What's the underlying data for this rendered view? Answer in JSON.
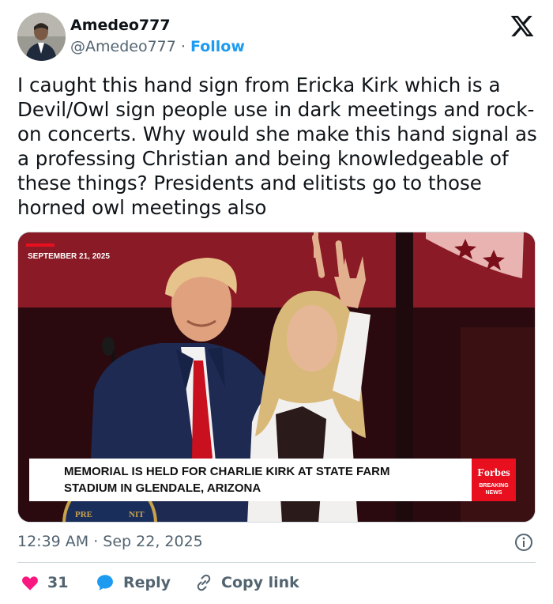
{
  "author": {
    "display_name": "Amedeo777",
    "handle": "@Amedeo777",
    "separator": "·",
    "follow_label": "Follow"
  },
  "tweet": {
    "text": "I caught this hand sign from Ericka Kirk which is a Devil/Owl sign people use in dark meetings and rock-on concerts. Why would she make this hand signal as a professing Christian and being knowledgeable of these things? Presidents and elitists go to those horned owl meetings also"
  },
  "media": {
    "date_label": "SEPTEMBER 21, 2025",
    "headline_line1": "MEMORIAL IS HELD FOR CHARLIE KIRK AT STATE FARM",
    "headline_line2": "STADIUM IN GLENDALE, ARIZONA",
    "brand": "Forbes",
    "brand_sub1": "BREAKING",
    "brand_sub2": "NEWS",
    "seal_text_left": "PRE",
    "seal_text_right": "NIT"
  },
  "footer": {
    "timestamp": "12:39 AM · Sep 22, 2025",
    "like_count": "31",
    "reply_label": "Reply",
    "copy_link_label": "Copy link"
  },
  "colors": {
    "like": "#f91880",
    "reply": "#1d9bf0",
    "follow": "#1d9bf0",
    "forbes_red": "#e8101f"
  },
  "icons": [
    "x-logo-icon",
    "info-icon",
    "heart-icon",
    "reply-bubble-icon",
    "link-icon"
  ]
}
